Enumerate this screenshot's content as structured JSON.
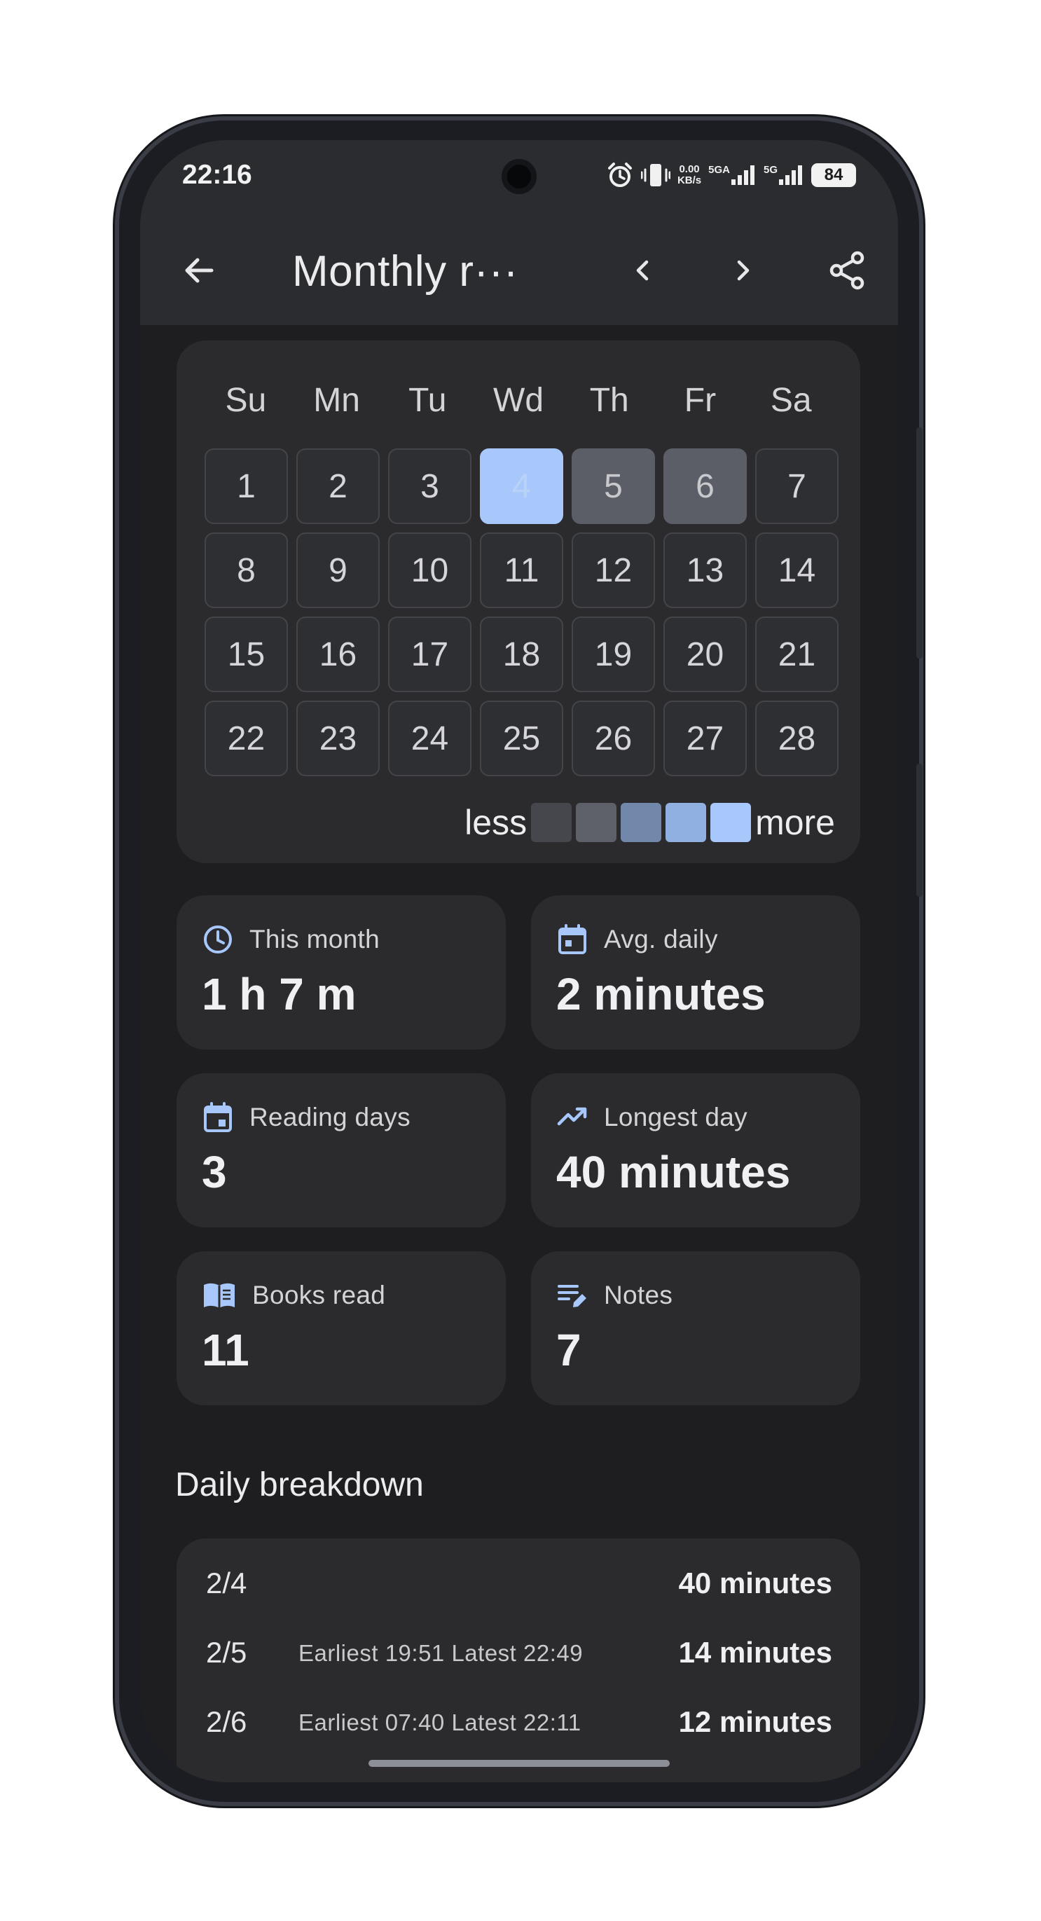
{
  "status_bar": {
    "time": "22:16",
    "net_speed_value": "0.00",
    "net_speed_unit": "KB/s",
    "sim1_label": "5GA",
    "sim2_label": "5G",
    "battery": "84",
    "icons": [
      "alarm-icon",
      "vibrate-icon",
      "signal-icon",
      "battery-icon"
    ]
  },
  "app_bar": {
    "title": "Monthly r···",
    "icons": [
      "back-arrow-icon",
      "chevron-left-icon",
      "chevron-right-icon",
      "share-icon"
    ]
  },
  "calendar": {
    "weekdays": [
      "Su",
      "Mn",
      "Tu",
      "Wd",
      "Th",
      "Fr",
      "Sa"
    ],
    "days": [
      "1",
      "2",
      "3",
      "4",
      "5",
      "6",
      "7",
      "8",
      "9",
      "10",
      "11",
      "12",
      "13",
      "14",
      "15",
      "16",
      "17",
      "18",
      "19",
      "20",
      "21",
      "22",
      "23",
      "24",
      "25",
      "26",
      "27",
      "28"
    ],
    "active_days": [
      {
        "day": "4",
        "level": "max"
      },
      {
        "day": "5",
        "level": 1
      },
      {
        "day": "6",
        "level": 1
      }
    ],
    "legend": {
      "less": "less",
      "more": "more",
      "colors": [
        "#45474d",
        "#5d6068",
        "#7288aa",
        "#8fb0e0",
        "#a8c7fa"
      ]
    }
  },
  "stats": {
    "this_month": {
      "label": "This month",
      "value": "1 h 7 m",
      "icon": "clock-icon"
    },
    "avg_daily": {
      "label": "Avg. daily",
      "value": "2 minutes",
      "icon": "calendar-icon"
    },
    "reading_days": {
      "label": "Reading days",
      "value": "3",
      "icon": "calendar-event-icon"
    },
    "longest_day": {
      "label": "Longest day",
      "value": "40 minutes",
      "icon": "trending-up-icon"
    },
    "books_read": {
      "label": "Books read",
      "value": "11",
      "icon": "book-icon"
    },
    "notes": {
      "label": "Notes",
      "value": "7",
      "icon": "edit-note-icon"
    }
  },
  "breakdown": {
    "title": "Daily breakdown",
    "rows": [
      {
        "date": "2/4",
        "detail": "",
        "duration": "40 minutes"
      },
      {
        "date": "2/5",
        "detail": "Earliest 19:51   Latest 22:49",
        "duration": "14 minutes"
      },
      {
        "date": "2/6",
        "detail": "Earliest 07:40   Latest 22:11",
        "duration": "12 minutes"
      }
    ]
  },
  "colors": {
    "accent": "#a8c7fa",
    "surface": "#2b2b2e",
    "background": "#1e1e20"
  }
}
